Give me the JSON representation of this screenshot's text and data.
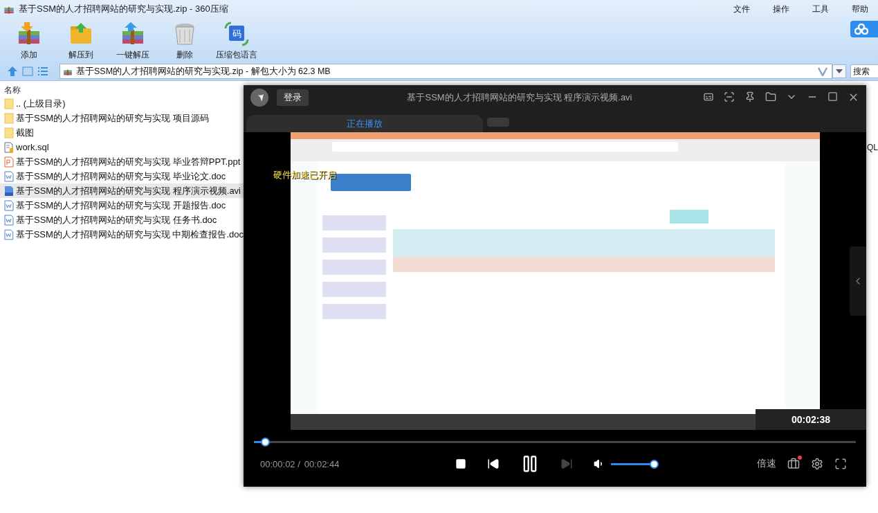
{
  "window": {
    "title": "基于SSM的人才招聘网站的研究与实现.zip - 360压缩"
  },
  "menu": [
    "文件",
    "操作",
    "工具",
    "帮助"
  ],
  "toolbar": [
    {
      "label": "添加",
      "kind": "add"
    },
    {
      "label": "解压到",
      "kind": "extract"
    },
    {
      "label": "一键解压",
      "kind": "quick"
    },
    {
      "label": "删除",
      "kind": "delete"
    },
    {
      "label": "压缩包语言",
      "kind": "language",
      "icon_text": "码"
    }
  ],
  "address": {
    "value": "基于SSM的人才招聘网站的研究与实现.zip - 解包大小为 62.3 MB"
  },
  "search": {
    "placeholder": "搜索"
  },
  "file_list": {
    "columns": [
      "名称"
    ],
    "rows": [
      {
        "name": ".. (上级目录)",
        "kind": "up",
        "selected": false
      },
      {
        "name": "基于SSM的人才招聘网站的研究与实现 项目源码",
        "kind": "folder",
        "selected": false
      },
      {
        "name": "截图",
        "kind": "folder",
        "selected": false
      },
      {
        "name": "work.sql",
        "kind": "sql",
        "selected": false,
        "type": "QL"
      },
      {
        "name": "基于SSM的人才招聘网站的研究与实现 毕业答辩PPT.ppt",
        "kind": "ppt",
        "selected": false
      },
      {
        "name": "基于SSM的人才招聘网站的研究与实现 毕业论文.doc",
        "kind": "doc",
        "selected": false
      },
      {
        "name": "基于SSM的人才招聘网站的研究与实现 程序演示视频.avi",
        "kind": "video",
        "selected": true
      },
      {
        "name": "基于SSM的人才招聘网站的研究与实现 开题报告.doc",
        "kind": "doc",
        "selected": false
      },
      {
        "name": "基于SSM的人才招聘网站的研究与实现 任务书.doc",
        "kind": "doc",
        "selected": false
      },
      {
        "name": "基于SSM的人才招聘网站的研究与实现 中期检查报告.doc",
        "kind": "doc",
        "selected": false
      }
    ]
  },
  "player": {
    "login": "登录",
    "title": "基于SSM的人才招聘网站的研究与实现 程序演示视频.avi",
    "tabs": [
      {
        "label": "正在播放",
        "selected": true
      },
      {
        "selected": false
      }
    ],
    "osd": "硬件加速已开启",
    "hover_time": "00:02:38",
    "progress": {
      "level": 0.018
    },
    "elapsed": "00:00:02 /",
    "duration": "00:02:44",
    "playing": true,
    "next_disabled": true,
    "volume": {
      "level": 1
    },
    "speed": "倍速",
    "toolbox_badge": true
  }
}
